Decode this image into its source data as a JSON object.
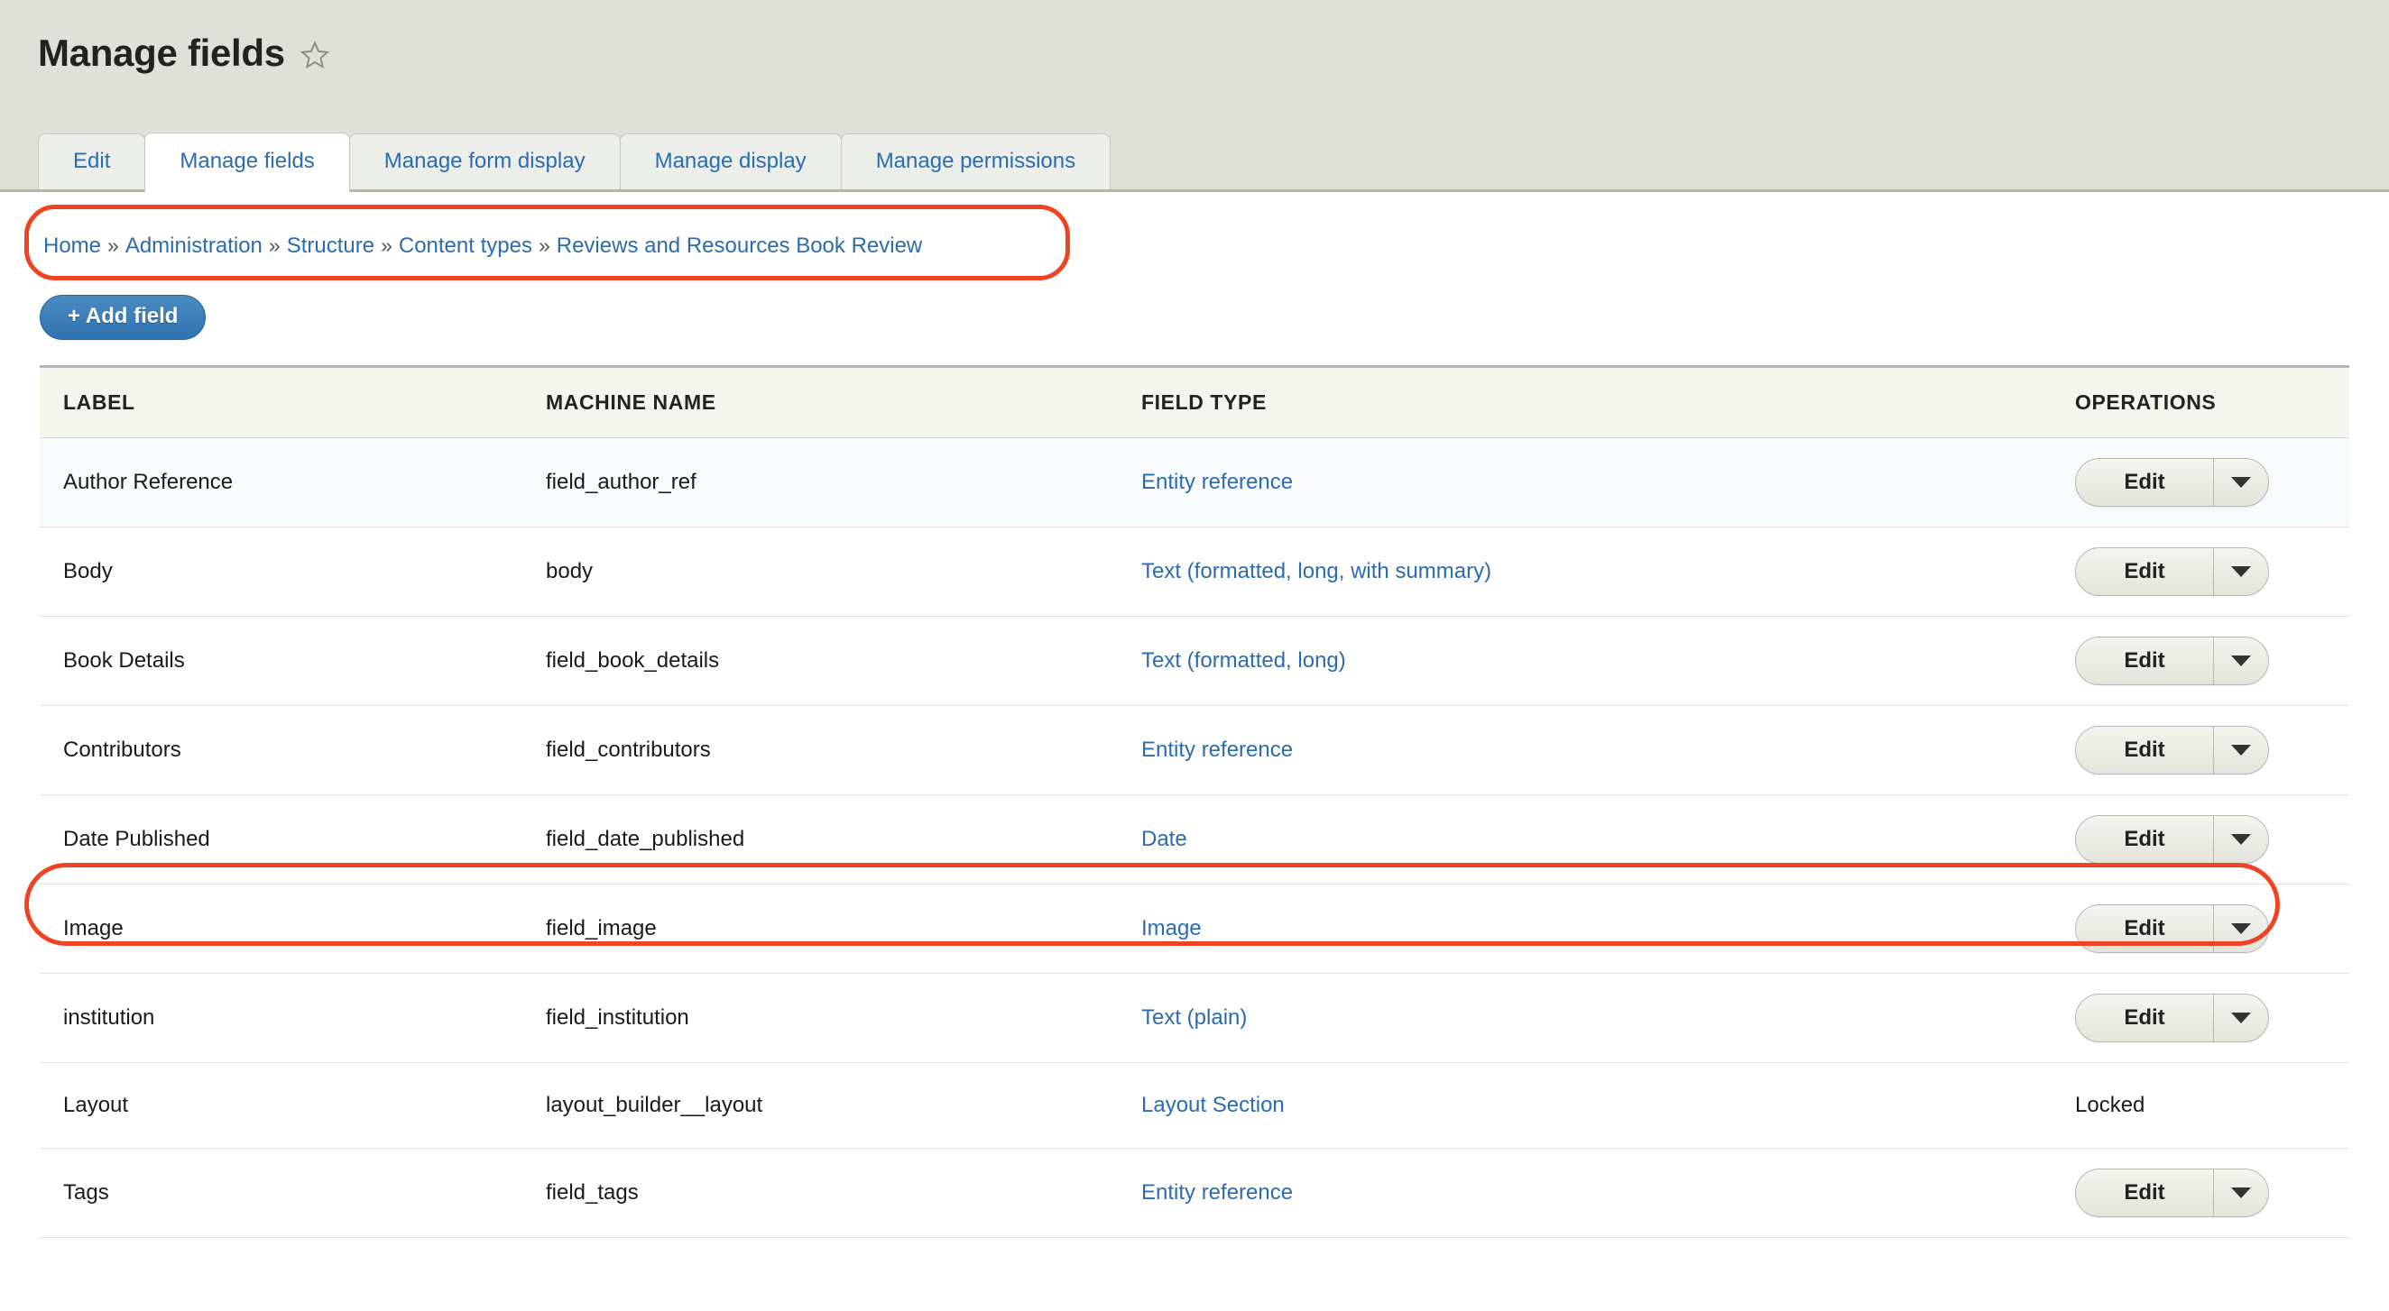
{
  "header": {
    "title": "Manage fields",
    "favorite_icon": "star-icon",
    "tabs": [
      {
        "label": "Edit",
        "active": false
      },
      {
        "label": "Manage fields",
        "active": true
      },
      {
        "label": "Manage form display",
        "active": false
      },
      {
        "label": "Manage display",
        "active": false
      },
      {
        "label": "Manage permissions",
        "active": false
      }
    ]
  },
  "breadcrumb": {
    "separator": "»",
    "items": [
      "Home",
      "Administration",
      "Structure",
      "Content types",
      "Reviews and Resources Book Review"
    ]
  },
  "toolbar": {
    "add_field_label": "+ Add field"
  },
  "table": {
    "columns": [
      "LABEL",
      "MACHINE NAME",
      "FIELD TYPE",
      "OPERATIONS"
    ],
    "rows": [
      {
        "label": "Author Reference",
        "machine_name": "field_author_ref",
        "field_type": "Entity reference",
        "operation": "Edit",
        "locked": false,
        "highlighted": false
      },
      {
        "label": "Body",
        "machine_name": "body",
        "field_type": "Text (formatted, long, with summary)",
        "operation": "Edit",
        "locked": false,
        "highlighted": false
      },
      {
        "label": "Book Details",
        "machine_name": "field_book_details",
        "field_type": "Text (formatted, long)",
        "operation": "Edit",
        "locked": false,
        "highlighted": false
      },
      {
        "label": "Contributors",
        "machine_name": "field_contributors",
        "field_type": "Entity reference",
        "operation": "Edit",
        "locked": false,
        "highlighted": false
      },
      {
        "label": "Date Published",
        "machine_name": "field_date_published",
        "field_type": "Date",
        "operation": "Edit",
        "locked": false,
        "highlighted": false
      },
      {
        "label": "Image",
        "machine_name": "field_image",
        "field_type": "Image",
        "operation": "Edit",
        "locked": false,
        "highlighted": true
      },
      {
        "label": "institution",
        "machine_name": "field_institution",
        "field_type": "Text (plain)",
        "operation": "Edit",
        "locked": false,
        "highlighted": false
      },
      {
        "label": "Layout",
        "machine_name": "layout_builder__layout",
        "field_type": "Layout Section",
        "operation": "Locked",
        "locked": true,
        "highlighted": false
      },
      {
        "label": "Tags",
        "machine_name": "field_tags",
        "field_type": "Entity reference",
        "operation": "Edit",
        "locked": false,
        "highlighted": false
      }
    ]
  },
  "colors": {
    "link": "#2b6cb0",
    "annotation": "#ef4423",
    "header_bg": "#e0e0da",
    "button_primary": "#3276b1",
    "row_odd_bg": "#f7fbfe"
  }
}
